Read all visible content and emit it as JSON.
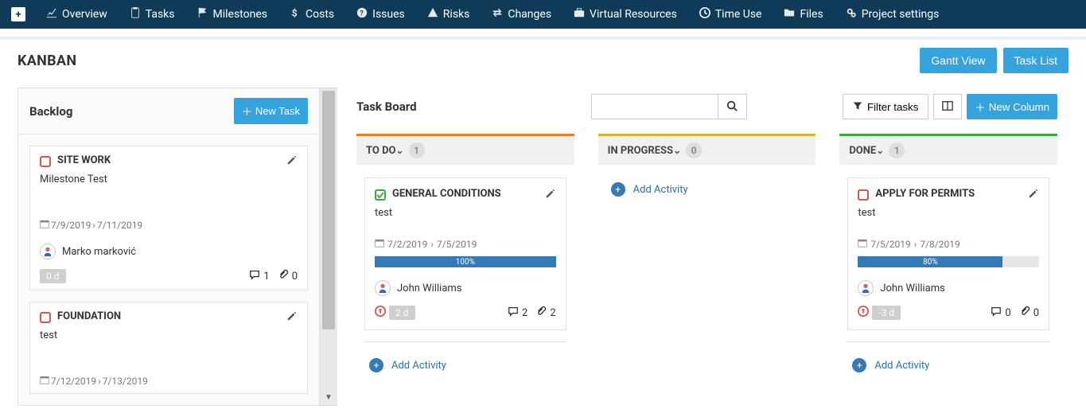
{
  "nav": {
    "items": [
      {
        "icon": "chart",
        "label": "Overview"
      },
      {
        "icon": "tasks",
        "label": "Tasks"
      },
      {
        "icon": "flag",
        "label": "Milestones"
      },
      {
        "icon": "dollar",
        "label": "Costs"
      },
      {
        "icon": "question",
        "label": "Issues"
      },
      {
        "icon": "warning",
        "label": "Risks"
      },
      {
        "icon": "exchange",
        "label": "Changes"
      },
      {
        "icon": "briefcase",
        "label": "Virtual Resources"
      },
      {
        "icon": "clock",
        "label": "Time Use"
      },
      {
        "icon": "folder",
        "label": "Files"
      },
      {
        "icon": "cogs",
        "label": "Project settings"
      }
    ]
  },
  "page": {
    "title": "KANBAN",
    "gantt_view_label": "Gantt View",
    "task_list_label": "Task List"
  },
  "backlog": {
    "title": "Backlog",
    "new_task_label": "New Task",
    "cards": [
      {
        "title": "SITE WORK",
        "subtitle": "Milestone Test",
        "date_start": "7/9/2019",
        "date_end": "7/11/2019",
        "assignee": "Marko marković",
        "days_badge": "0 d",
        "comments": 1,
        "attachments": 0
      },
      {
        "title": "FOUNDATION",
        "subtitle": "test",
        "date_start": "7/12/2019",
        "date_end": "7/13/2019"
      }
    ]
  },
  "board": {
    "title": "Task Board",
    "search_placeholder": "",
    "filter_label": "Filter tasks",
    "new_column_label": "New Column",
    "add_activity_label": "Add Activity",
    "columns": [
      {
        "name": "TO DO",
        "accent": "#e67e22",
        "count": 1,
        "cards": [
          {
            "done": true,
            "title": "GENERAL CONDITIONS",
            "subtitle": "test",
            "date_start": "7/2/2019",
            "date_end": "7/5/2019",
            "progress_pct": 100,
            "progress_label": "100%",
            "assignee": "John Williams",
            "overdue": true,
            "days_badge": "2 d",
            "comments": 2,
            "attachments": 2
          }
        ]
      },
      {
        "name": "IN PROGRESS",
        "accent": "#d8b62c",
        "count": 0,
        "cards": []
      },
      {
        "name": "DONE",
        "accent": "#3fa83f",
        "count": 1,
        "cards": [
          {
            "done": false,
            "title": "APPLY FOR PERMITS",
            "subtitle": "test",
            "date_start": "7/5/2019",
            "date_end": "7/8/2019",
            "progress_pct": 80,
            "progress_label": "80%",
            "assignee": "John Williams",
            "overdue": true,
            "days_badge": "-3 d",
            "comments": 0,
            "attachments": 0
          }
        ]
      }
    ]
  }
}
